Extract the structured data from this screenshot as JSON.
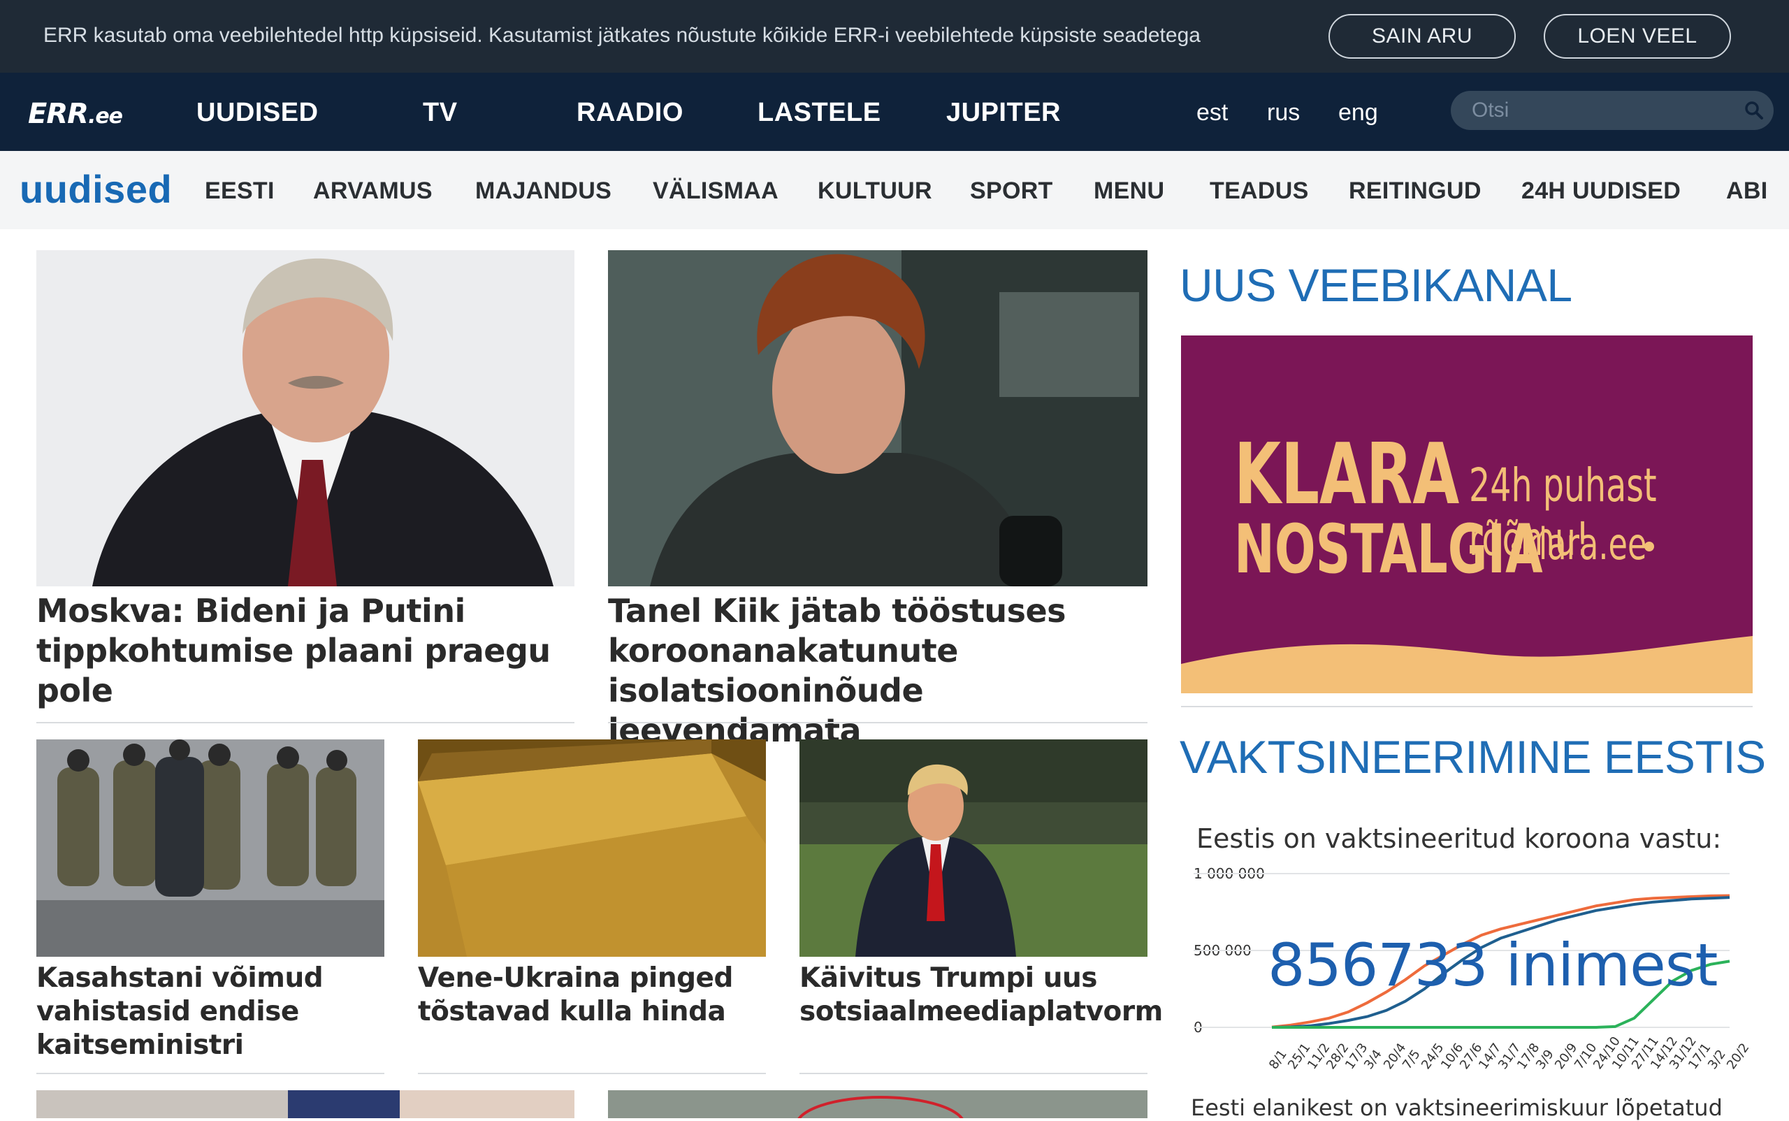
{
  "cookie_bar": {
    "text": "ERR kasutab oma veebilehtedel http küpsiseid. Kasutamist jätkates nõustute kõikide ERR-i veebilehtede küpsiste seadetega",
    "accept_label": "SAIN ARU",
    "more_label": "LOEN VEEL"
  },
  "topnav": {
    "logo": "ERR",
    "logo_suffix": ".ee",
    "items": [
      "UUDISED",
      "TV",
      "RAADIO",
      "LASTELE",
      "JUPITER"
    ],
    "languages": [
      "est",
      "rus",
      "eng"
    ],
    "search_placeholder": "Otsi"
  },
  "secnav": {
    "title": "uudised",
    "items": [
      "EESTI",
      "ARVAMUS",
      "MAJANDUS",
      "VÄLISMAA",
      "KULTUUR",
      "SPORT",
      "MENU",
      "TEADUS",
      "REITINGUD",
      "24H UUDISED",
      "ABI"
    ]
  },
  "articles": {
    "main": [
      {
        "headline": "Moskva: Bideni ja Putini tippkohtumise plaani praegu pole"
      },
      {
        "headline": "Tanel Kiik jätab tööstuses koroonanakatunute isolatsiooninõude leevendamata"
      }
    ],
    "row": [
      {
        "headline": "Kasahstani võimud vahistasid endise kaitseministri"
      },
      {
        "headline": "Vene-Ukraina pinged tõstavad kulla hinda"
      },
      {
        "headline": "Käivitus Trumpi uus sotsiaalmeediaplatvorm"
      }
    ]
  },
  "sidebar": {
    "channel_title": "UUS VEEBIKANAL",
    "banner": {
      "line1": "KLARA",
      "line2": "NOSTALGIA",
      "slogan": "24h puhast rõõmu!",
      "url": "klara.ee"
    },
    "vaccination_title": "VAKTSINEERIMINE EESTIS",
    "chart_heading": "Eestis on vaktsineeritud koroona vastu:",
    "count_number": "856733",
    "count_unit": "inimest",
    "chart_footer": "Eesti elanikest on vaktsineerimiskuur lõpetatud"
  },
  "colors": {
    "cookie_bg": "#1f2a36",
    "nav_bg": "#0f223a",
    "brand_blue": "#1869b4",
    "banner_bg": "#7b1656",
    "banner_text": "#f3bf77",
    "series_orange": "#ee6b3c",
    "series_blue": "#1f5f8f",
    "series_green": "#2bb25a"
  },
  "chart_data": {
    "type": "line",
    "title": "Eestis on vaktsineeritud koroona vastu:",
    "ylim": [
      0,
      1000000
    ],
    "yticks": [
      "0",
      "500 000",
      "1 000 000"
    ],
    "x": [
      "8/1",
      "25/1",
      "11/2",
      "28/2",
      "17/3",
      "3/4",
      "20/4",
      "7/5",
      "24/5",
      "10/6",
      "27/6",
      "14/7",
      "31/7",
      "17/8",
      "3/9",
      "20/9",
      "7/10",
      "24/10",
      "10/11",
      "27/11",
      "14/12",
      "31/12",
      "17/1",
      "3/2",
      "20/2"
    ],
    "series": [
      {
        "color": "#ee6b3c",
        "values": [
          2000,
          15000,
          35000,
          60000,
          100000,
          160000,
          230000,
          310000,
          400000,
          470000,
          540000,
          600000,
          640000,
          670000,
          700000,
          730000,
          760000,
          790000,
          810000,
          830000,
          840000,
          845000,
          850000,
          855000,
          857000
        ]
      },
      {
        "color": "#1f5f8f",
        "values": [
          0,
          3000,
          10000,
          25000,
          45000,
          70000,
          110000,
          170000,
          250000,
          350000,
          440000,
          520000,
          580000,
          620000,
          660000,
          700000,
          730000,
          760000,
          780000,
          800000,
          815000,
          825000,
          835000,
          840000,
          845000
        ]
      },
      {
        "color": "#2bb25a",
        "values": [
          0,
          0,
          0,
          0,
          0,
          0,
          0,
          0,
          0,
          0,
          0,
          0,
          0,
          0,
          0,
          0,
          0,
          0,
          5000,
          60000,
          180000,
          300000,
          370000,
          410000,
          430000
        ]
      }
    ]
  }
}
